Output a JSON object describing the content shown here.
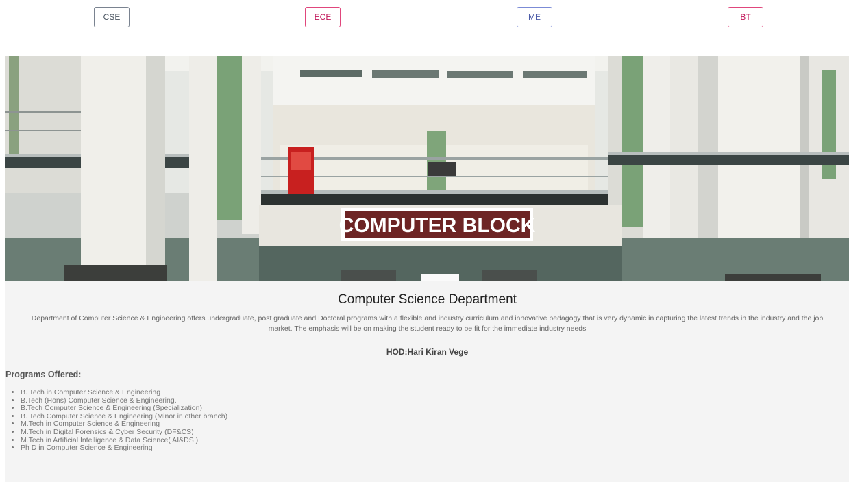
{
  "nav": {
    "buttons": [
      {
        "label": "CSE"
      },
      {
        "label": "ECE"
      },
      {
        "label": "ME"
      },
      {
        "label": "BT"
      }
    ]
  },
  "hero": {
    "sign_text": "COMPUTER BLOCK"
  },
  "department": {
    "title": "Computer Science Department",
    "description": "Department of Computer Science & Engineering offers undergraduate, post graduate and Doctoral programs with a flexible and industry curriculum and innovative pedagogy that is very dynamic in capturing the latest trends in the industry and the job market. The emphasis will be on making the student ready to be fit for the immediate industry needs",
    "hod": "HOD:Hari Kiran Vege",
    "programs_heading": "Programs Offered:",
    "programs": [
      "B. Tech in Computer Science & Engineering",
      "B.Tech (Hons) Computer Science & Engineering.",
      "B.Tech Computer Science & Engineering (Specialization)",
      "B. Tech Computer Science & Engineering (Minor in other branch)",
      "M.Tech in Computer Science & Engineering",
      "M.Tech in Digital Forensics & Cyber Security (DF&CS)",
      "M.Tech in Artificial Intelligence & Data Science( AI&DS )",
      "Ph D in Computer Science & Engineering"
    ]
  }
}
